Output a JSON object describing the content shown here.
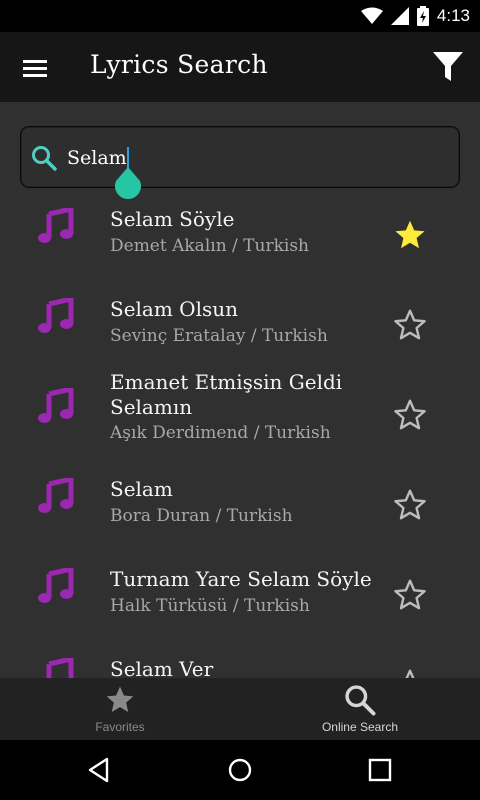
{
  "status_bar": {
    "time": "4:13"
  },
  "app_bar": {
    "title": "Lyrics Search"
  },
  "search": {
    "value": "Selam"
  },
  "results": [
    {
      "title": "Selam Söyle",
      "subtitle": "Demet Akalın / Turkish",
      "favorite": true
    },
    {
      "title": "Selam Olsun",
      "subtitle": "Sevinç Eratalay / Turkish",
      "favorite": false
    },
    {
      "title": "Emanet Etmişsin Geldi",
      "title_line2": "Selamın",
      "subtitle": "Aşık Derdimend / Turkish",
      "favorite": false
    },
    {
      "title": "Selam",
      "subtitle": "Bora Duran / Turkish",
      "favorite": false
    },
    {
      "title": "Turnam Yare Selam Söyle",
      "subtitle": "Halk Türküsü / Turkish",
      "favorite": false
    },
    {
      "title": "Selam Ver",
      "subtitle": "",
      "favorite": false
    }
  ],
  "bottom_tabs": [
    {
      "label": "Favorites",
      "icon": "star-icon",
      "active": false
    },
    {
      "label": "Online Search",
      "icon": "search-icon",
      "active": true
    }
  ],
  "colors": {
    "note": "#9c27b0",
    "favorite_star": "#ffeb3b",
    "search_icon": "#4dd0c0",
    "caret_handle": "#26c6a5"
  },
  "icons": {
    "menu": "hamburger-menu-icon",
    "filter": "filter-icon",
    "result": "music-note-icon",
    "status": [
      "wifi-icon",
      "cellular-icon",
      "battery-charging-icon"
    ],
    "nav": [
      "back-icon",
      "home-icon",
      "recents-icon"
    ]
  }
}
